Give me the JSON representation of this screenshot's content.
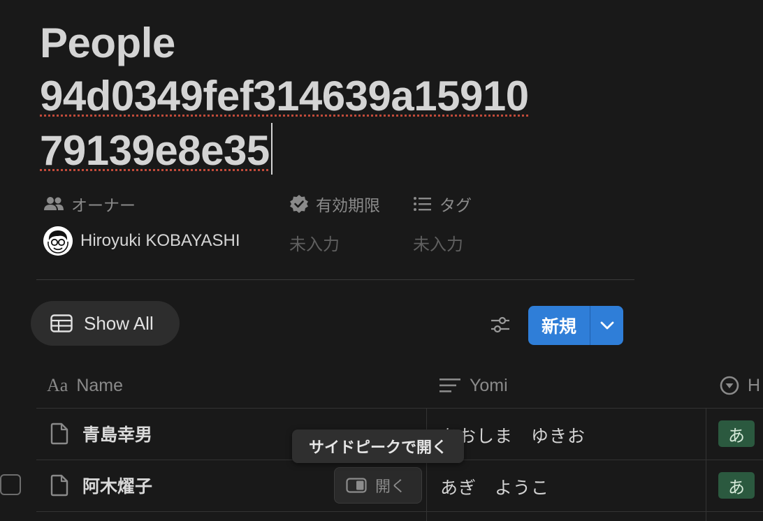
{
  "page": {
    "title_line1": "People",
    "title_line2": "94d0349fef314639a15910",
    "title_line3": "79139e8e35"
  },
  "properties": {
    "owner_label": "オーナー",
    "expiry_label": "有効期限",
    "tags_label": "タグ",
    "owner_name": "Hiroyuki KOBAYASHI",
    "expiry_value": "未入力",
    "tags_value": "未入力"
  },
  "toolbar": {
    "view_label": "Show All",
    "new_label": "新規"
  },
  "table": {
    "columns": [
      {
        "label": "Name",
        "icon": "text-aa-icon"
      },
      {
        "label": "Yomi",
        "icon": "text-lines-icon"
      },
      {
        "label": "H",
        "icon": "select-circle-icon"
      }
    ],
    "rows": [
      {
        "name": "青島幸男",
        "yomi": "あおしま　ゆきお",
        "tag": "あ"
      },
      {
        "name": "阿木燿子",
        "yomi": "あぎ　ようこ",
        "tag": "あ"
      }
    ]
  },
  "tooltip": {
    "text": "サイドピークで開く"
  },
  "open_button": {
    "label": "開く"
  },
  "colors": {
    "background": "#191919",
    "accent": "#2f7ed8",
    "tag_green": "#2b593f",
    "spellcheck": "#c14a3a"
  }
}
